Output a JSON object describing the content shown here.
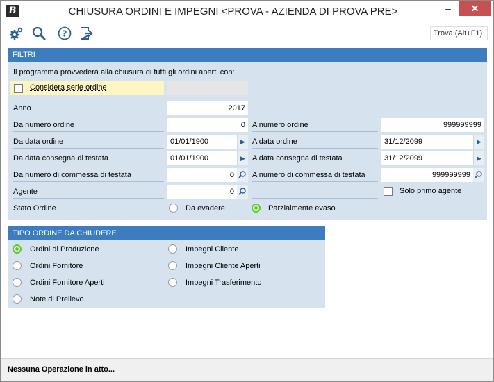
{
  "window": {
    "logo": "B",
    "title": "CHIUSURA ORDINI E IMPEGNI <PROVA - AZIENDA DI PROVA PRE>",
    "minimize": "–",
    "close": "✕"
  },
  "toolbar": {
    "icons": [
      "settings-icon",
      "search-icon",
      "help-icon",
      "exit-icon"
    ],
    "find_label": "Trova (Alt+F1)"
  },
  "filtri": {
    "header": "FILTRI",
    "intro": "Il programma provvederà alla chiusura di tutti gli ordini aperti con:",
    "considera_serie": {
      "label": "Considera serie ordine",
      "checked": false,
      "value": ""
    },
    "anno": {
      "label": "Anno",
      "value": "2017"
    },
    "da_numero_ordine": {
      "label": "Da numero ordine",
      "value": "0"
    },
    "a_numero_ordine": {
      "label": "A numero ordine",
      "value": "999999999"
    },
    "da_data_ordine": {
      "label": "Da data ordine",
      "value": "01/01/1900"
    },
    "a_data_ordine": {
      "label": "A data ordine",
      "value": "31/12/2099"
    },
    "da_data_consegna": {
      "label": "Da data consegna di testata",
      "value": "01/01/1900"
    },
    "a_data_consegna": {
      "label": "A data consegna di testata",
      "value": "31/12/2099"
    },
    "da_commessa": {
      "label": "Da numero di commessa di testata",
      "value": "0"
    },
    "a_commessa": {
      "label": "A numero di commessa di testata",
      "value": "999999999"
    },
    "agente": {
      "label": "Agente",
      "value": "0"
    },
    "solo_primo_agente": {
      "label": "Solo primo agente",
      "checked": false
    },
    "stato_ordine": {
      "label": "Stato Ordine",
      "options": [
        "Da evadere",
        "Parzialmente evaso"
      ],
      "selected": "Parzialmente evaso"
    }
  },
  "tipo_ordine": {
    "header": "TIPO ORDINE DA CHIUDERE",
    "options": [
      "Ordini di Produzione",
      "Impegni Cliente",
      "Ordini Fornitore",
      "Impegni Cliente Aperti",
      "Ordini Fornitore Aperti",
      "Impegni Trasferimento",
      "Note di Prelievo"
    ],
    "selected": "Ordini di Produzione"
  },
  "status": "Nessuna Operazione in atto...",
  "colors": {
    "accent": "#3c7cbf",
    "panel": "#d6e3ef",
    "radio_selected": "#5dc72d",
    "highlight_row": "#fdf6c3"
  }
}
